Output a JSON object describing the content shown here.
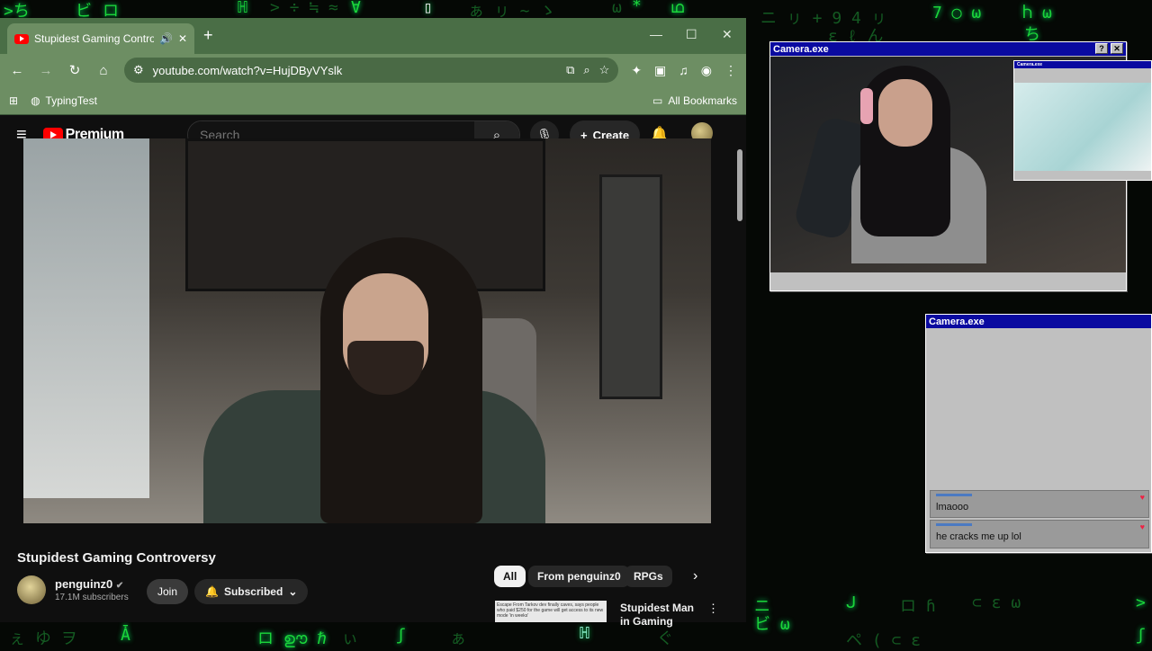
{
  "browser": {
    "tab_title": "Stupidest Gaming Controversy",
    "new_tab_icon": "+",
    "url": "youtube.com/watch?v=HujDByVYslk",
    "bookmark_1": "TypingTest",
    "all_bookmarks": "All Bookmarks"
  },
  "youtube": {
    "logo_text": "Premium",
    "search_placeholder": "Search",
    "create_label": "Create",
    "video_title": "Stupidest Gaming Controversy",
    "channel_name": "penguinz0",
    "subscribers": "17.1M subscribers",
    "join_label": "Join",
    "subscribed_label": "Subscribed",
    "chips": [
      "All",
      "From penguinz0",
      "RPGs"
    ],
    "rec_thumb_text": "Escape From Tarkov dev finally caves, says people who paid $250 for the game will get access to its new mode 'in weeks'",
    "rec_title": "Stupidest Man in Gaming"
  },
  "cam1": {
    "title": "Camera.exe",
    "help": "?",
    "close": "✕",
    "mini_title": "Camera.exe"
  },
  "cam2": {
    "title": "Camera.exe",
    "messages": [
      {
        "text": "lmaooo"
      },
      {
        "text": "he cracks me up lol"
      }
    ]
  },
  "colors": {
    "matrix_green": "#1bd63a",
    "chrome_green": "#6d8e63",
    "win_title": "#0a0aa0"
  },
  "matrix_top": [
    ">ち",
    "ビ",
    "ロ",
    "ℍ",
    "> ÷ ≒ ≈",
    "∀",
    "▯",
    "ぁ ㇼ ~ ゝ",
    "ω",
    "*",
    "ഥ"
  ],
  "matrix_right": [
    "ニ ㇼ + 9 4 ㇼ",
    "7 ◯ ω",
    "Ⴙ ω",
    "ち",
    "ε ℓ ん"
  ],
  "matrix_bottom_left": [
    "ぇ ゆ ヲ",
    "Ǡ",
    "ロ ഊ ℏ",
    "ぃ",
    "ʃ",
    "ぁ",
    "ぐ",
    "ℍ"
  ],
  "matrix_bottom_right": [
    "ニ",
    "ᒍ",
    "ロ ɦ",
    "⊂ ɛ ω",
    "ビ ω",
    "ペ ( ⊂ ε",
    ">",
    "ʃ"
  ]
}
